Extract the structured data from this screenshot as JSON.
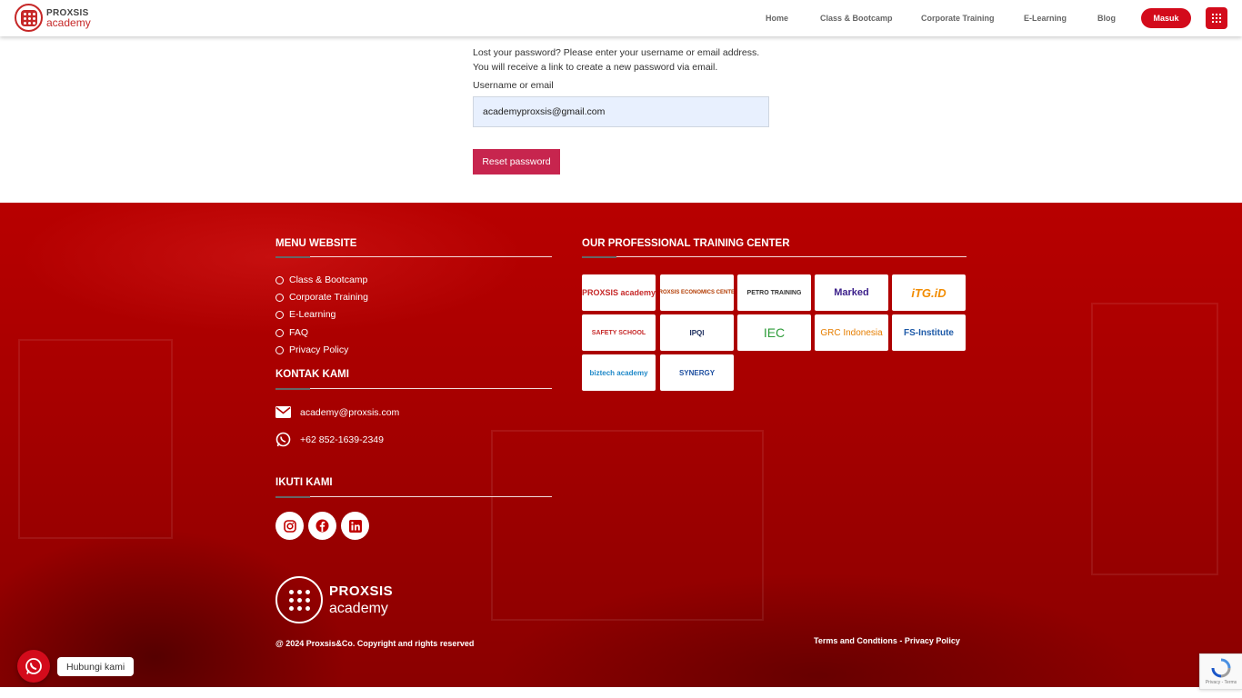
{
  "header": {
    "logo_line1": "PROXSIS",
    "logo_line2": "academy",
    "nav": [
      "Home",
      "Class & Bootcamp",
      "Corporate Training",
      "E-Learning",
      "Blog"
    ],
    "login_label": "Masuk"
  },
  "form": {
    "intro_line1": "Lost your password? Please enter your username or email address.",
    "intro_line2": "You will receive a link to create a new password via email.",
    "field_label": "Username or email",
    "field_value": "academyproxsis@gmail.com",
    "submit_label": "Reset password"
  },
  "footer": {
    "menu_title": "MENU WEBSITE",
    "menu_items": [
      "Class & Bootcamp",
      "Corporate Training",
      "E-Learning",
      "FAQ",
      "Privacy Policy"
    ],
    "contact_title": "KONTAK KAMI",
    "email": "academy@proxsis.com",
    "phone": "+62 852-1639-2349",
    "follow_title": "IKUTI KAMI",
    "social_icons": [
      "instagram-icon",
      "facebook-icon",
      "linkedin-icon"
    ],
    "brand_line1": "PROXSIS",
    "brand_line2": "academy",
    "copyright": "@ 2024 Proxsis&Co. Copyright and rights reserved",
    "partners_title": "OUR PROFESSIONAL TRAINING CENTER",
    "partners": [
      "PROXSIS academy",
      "PROXSIS ECONOMICS CENTER",
      "PETRO TRAINING",
      "Marked",
      "iTG.iD",
      "SAFETY SCHOOL",
      "IPQI",
      "IEC",
      "GRC Indonesia",
      "FS-Institute",
      "biztech academy",
      "SYNERGY"
    ],
    "terms": "Terms and Condtions - Privacy Policy"
  },
  "floating": {
    "whatsapp_label": "Hubungi kami",
    "recaptcha_text": "Privacy - Terms"
  },
  "colors": {
    "brand_red": "#d30b1b",
    "reset_button": "#c7254e",
    "input_bg": "#e8f0fe"
  }
}
